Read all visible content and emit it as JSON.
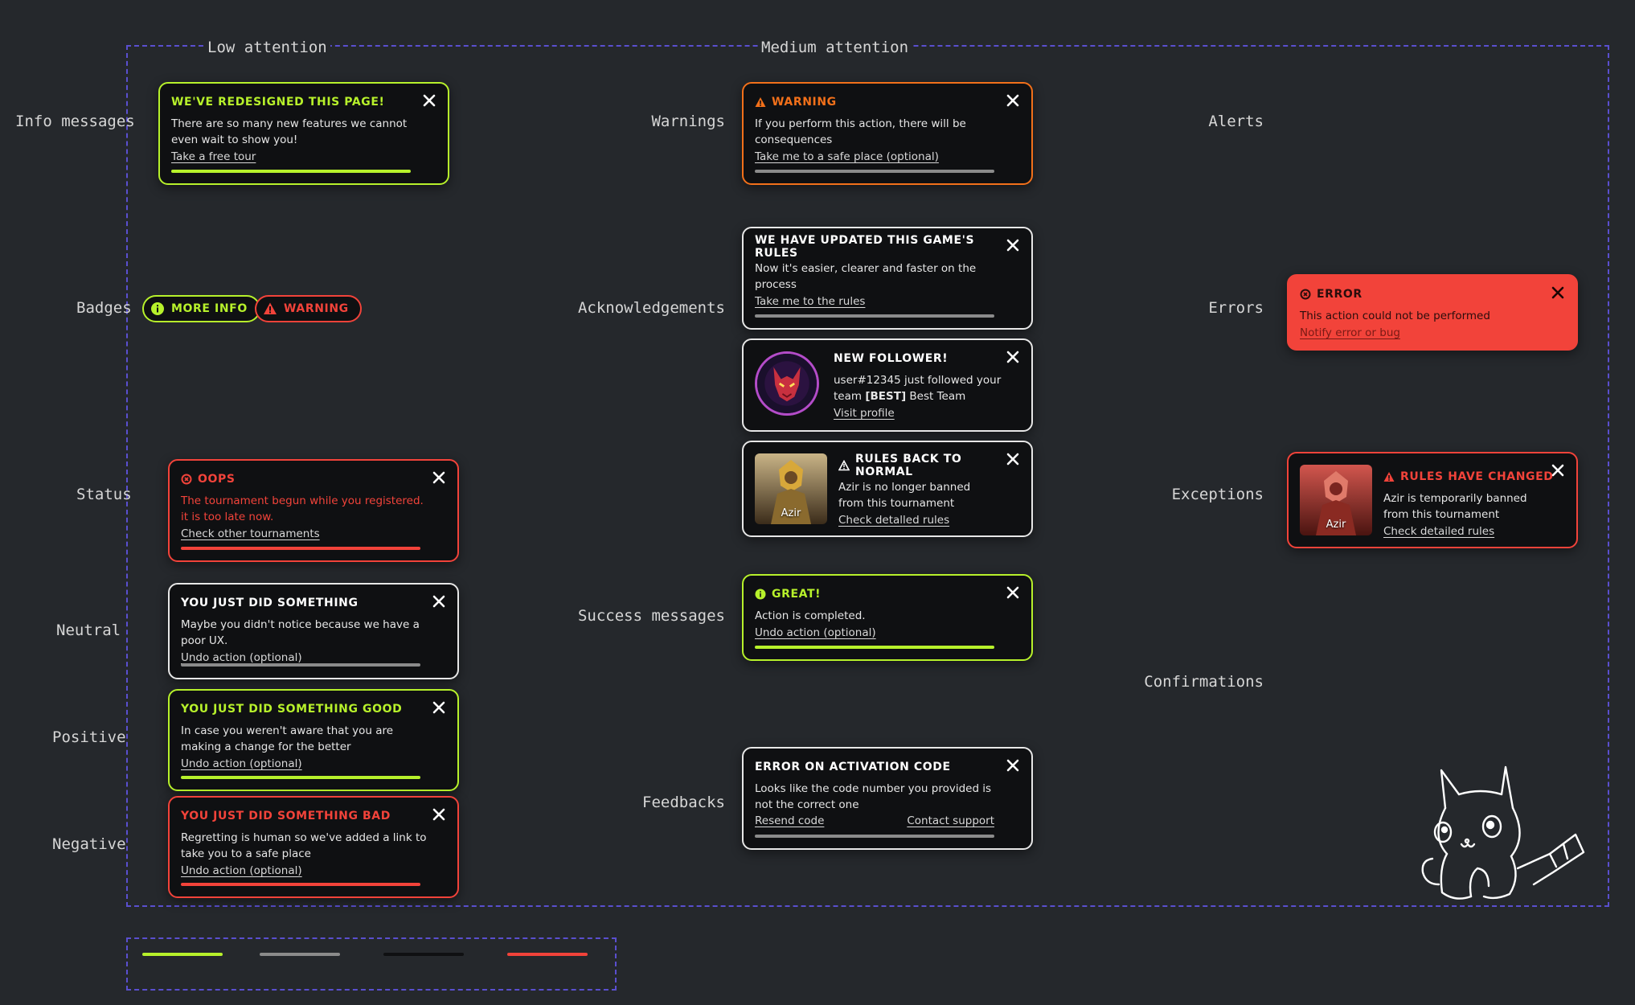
{
  "columns": {
    "low": "Low attention",
    "medium": "Medium attention"
  },
  "rows": {
    "info_messages": "Info messages",
    "badges": "Badges",
    "status": "Status",
    "neutral": "Neutral",
    "positive": "Positive",
    "negative": "Negative",
    "warnings": "Warnings",
    "acknowledgements": "Acknowledgements",
    "success_messages": "Success messages",
    "feedbacks": "Feedbacks",
    "alerts": "Alerts",
    "errors": "Errors",
    "exceptions": "Exceptions",
    "confirmations": "Confirmations"
  },
  "colors": {
    "background": "#25282c",
    "green": "#b7f12b",
    "orange": "#f2701a",
    "red": "#f2433a",
    "gray": "#8b8b8b",
    "dark": "#0f1012",
    "frame": "#5a4fcf"
  },
  "toasts": {
    "redesign": {
      "title": "WE'VE REDESIGNED THIS PAGE!",
      "body": "There are so many new features we cannot even wait to show you!",
      "link": "Take a free tour"
    },
    "oops": {
      "title": "OOPS",
      "body": "The tournament begun while you registered. it is too late now.",
      "link": "Check other tournaments"
    },
    "neutral": {
      "title": "YOU JUST DID SOMETHING",
      "body": "Maybe you didn't notice because we have a poor UX.",
      "link": "Undo action (optional)"
    },
    "positive": {
      "title": "YOU JUST DID SOMETHING GOOD",
      "body": "In case you weren't aware that you are making a change for the better",
      "link": "Undo action (optional)"
    },
    "negative": {
      "title": "YOU JUST DID SOMETHING BAD",
      "body": "Regretting is human so we've added a link to take you to a safe place",
      "link": "Undo action (optional)"
    },
    "warning": {
      "title": "WARNING",
      "body": "If you perform this action, there will be consequences",
      "link": "Take me to a safe place (optional)"
    },
    "rules_updated": {
      "title": "WE HAVE UPDATED THIS GAME'S RULES",
      "body": "Now it's easier, clearer and faster on the process",
      "link": "Take me to the rules"
    },
    "new_follower": {
      "title": "NEW FOLLOWER!",
      "body_pre": "user#12345 just followed your team ",
      "body_bold": "[BEST]",
      "body_post": " Best Team",
      "link": "Visit profile"
    },
    "rules_normal": {
      "title": "RULES BACK TO NORMAL",
      "body": "Azir is no longer banned from this tournament",
      "link": "Check detalled rules",
      "thumb_caption": "Azir"
    },
    "great": {
      "title": "GREAT!",
      "body": "Action is completed.",
      "link": "Undo action (optional)"
    },
    "activation": {
      "title": "ERROR ON ACTIVATION CODE",
      "body": "Looks like the code number you provided is not the correct one",
      "link_left": "Resend code",
      "link_right": "Contact support"
    },
    "error": {
      "title": "ERROR",
      "body": "This action could not be performed",
      "link": "Notify error or bug"
    },
    "rules_changed": {
      "title": "RULES HAVE CHANGED",
      "body": "Azir is temporarily banned from this tournament",
      "link": "Check detailed rules",
      "thumb_caption": "Azir"
    }
  },
  "badges": {
    "more_info": "MORE INFO",
    "warning": "WARNING"
  },
  "legend": [
    "#b7f12b",
    "#8b8b8b",
    "#0f1012",
    "#f2433a"
  ]
}
